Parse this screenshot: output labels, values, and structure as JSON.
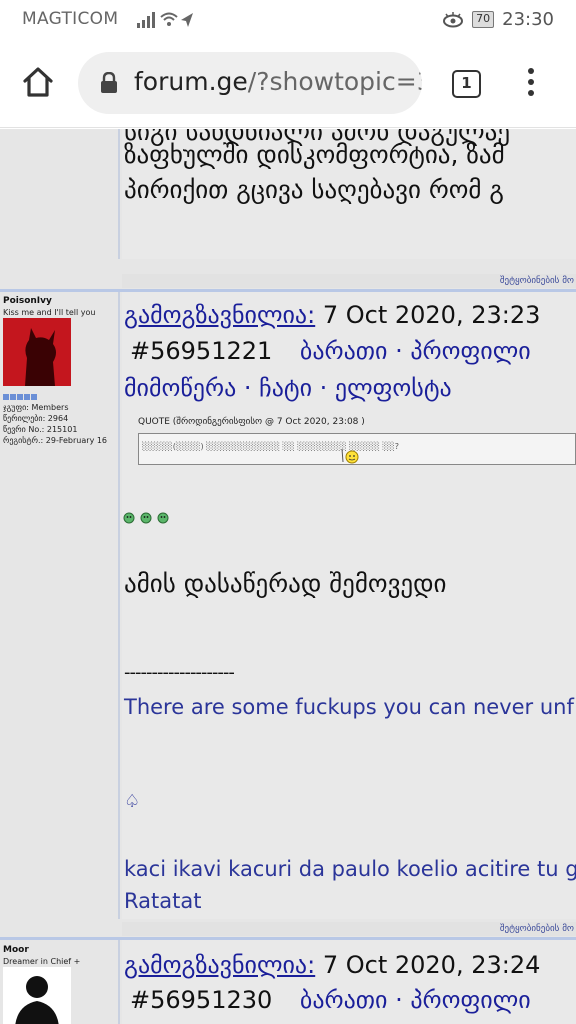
{
  "status_bar": {
    "carrier": "MAGTICOM",
    "signal_glyphs": "▎▍▌█ ◔ ➤",
    "eye_glyph": "◉",
    "battery": "70",
    "time": "23:30"
  },
  "browser": {
    "url_host": "forum.ge",
    "url_rest": "/?showtopic=3",
    "tab_count": "1"
  },
  "prev_post": {
    "line1": "სიგი სანდნიალი ამონ დაგულაე",
    "line2": "ზაფხულში დისკომფორტია, ზამ",
    "line3": "პირიქით გცივა საღებავი რომ გ",
    "footer": "შეტყობინების მო"
  },
  "post1": {
    "user": {
      "name": "PoisonIvy",
      "title": "Kiss me and I'll tell you",
      "meta1": "ჯგუფი: Members",
      "meta2": "წერილები: 2964",
      "meta3": "წევრი No.: 215101",
      "meta4": "რეგისტრ.: 29-February 16"
    },
    "sent_label": "გამოგზავნილია:",
    "date": "7 Oct 2020, 23:23",
    "post_id": "#56951221",
    "links1": "ბარათი · პროფილი",
    "links2": "მიმოწერა · ჩატი · ელფოსტა",
    "quote_title": "QUOTE (შროდინგერისფისო @ 7 Oct 2020, 23:08 )",
    "quote_text": "░░░░░(░░░░) ░░░░░░░░░░░░ ░░ ░░░░░░░░ ░░░░░ ░░?",
    "main_text": "ამის დასაწერად შემოვედი",
    "dashes": "--------------------",
    "sig1": "There are some fuckups you can never unf",
    "spade": "♤",
    "sig2": "kaci ikavi kacuri da paulo koelio acitire tu g",
    "sig3": "Ratatat",
    "footer": "შეტყობინების მო"
  },
  "post2": {
    "user": {
      "name": "Moor",
      "title": "Dreamer in Chief +"
    },
    "sent_label": "გამოგზავნილია:",
    "date": "7 Oct 2020, 23:24",
    "post_id": "#56951230",
    "links1": "ბარათი · პროფილი"
  },
  "colors": {
    "link": "#1a1f9a",
    "signature": "#2b3599",
    "separator": "#b9c8e6",
    "avatar_red": "#c0151c"
  }
}
